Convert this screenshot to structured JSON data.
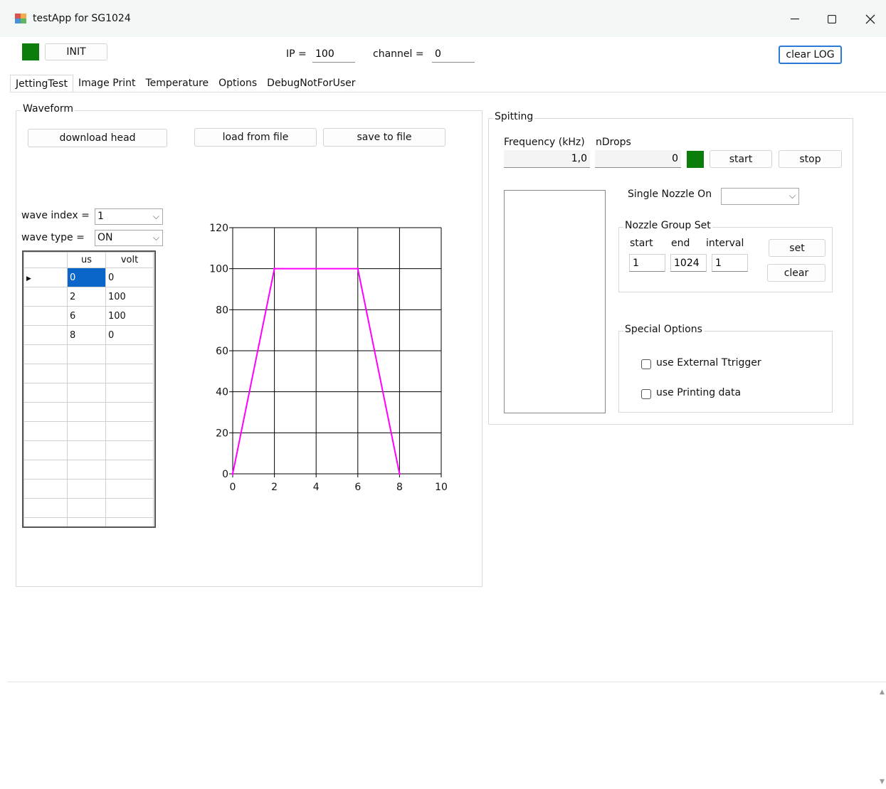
{
  "window": {
    "title": "testApp for SG1024"
  },
  "top": {
    "init_label": "INIT",
    "ip_label": "IP =",
    "ip_value": "100",
    "channel_label": "channel =",
    "channel_value": "0",
    "clear_log_label": "clear LOG",
    "led_color": "#0a7d0a"
  },
  "tabs": [
    "JettingTest",
    "Image Print",
    "Temperature",
    "Options",
    "DebugNotForUser"
  ],
  "waveform": {
    "title": "Waveform",
    "download_label": "download head",
    "load_label": "load from file",
    "save_label": "save to file",
    "wave_index_label": "wave index =",
    "wave_index_value": "1",
    "wave_type_label": "wave type =",
    "wave_type_value": "ON",
    "grid": {
      "headers": [
        "us",
        "volt"
      ],
      "rows": [
        [
          "0",
          "0"
        ],
        [
          "2",
          "100"
        ],
        [
          "6",
          "100"
        ],
        [
          "8",
          "0"
        ]
      ]
    }
  },
  "chart_data": {
    "type": "line",
    "x": [
      0,
      2,
      6,
      8
    ],
    "series": [
      {
        "values": [
          0,
          100,
          100,
          0
        ],
        "color": "#ff00ff"
      }
    ],
    "xlim": [
      0,
      10
    ],
    "ylim": [
      0,
      120
    ],
    "xticks": [
      "0",
      "2",
      "4",
      "6",
      "8",
      "10"
    ],
    "yticks": [
      "0",
      "20",
      "40",
      "60",
      "80",
      "100",
      "120"
    ],
    "grid": true
  },
  "spitting": {
    "title": "Spitting",
    "frequency_label": "Frequency (kHz)",
    "frequency_value": "1,0",
    "ndrops_label": "nDrops",
    "ndrops_value": "0",
    "start_label": "start",
    "stop_label": "stop",
    "single_nozzle_label": "Single Nozzle On",
    "nozzle_group": {
      "title": "Nozzle Group Set",
      "start_label": "start",
      "end_label": "end",
      "interval_label": "interval",
      "start_value": "1",
      "end_value": "1024",
      "interval_value": "1",
      "set_label": "set",
      "clear_label": "clear"
    },
    "special": {
      "title": "Special Options",
      "external_trigger_label": "use External Ttrigger",
      "printing_data_label": "use Printing data"
    }
  }
}
